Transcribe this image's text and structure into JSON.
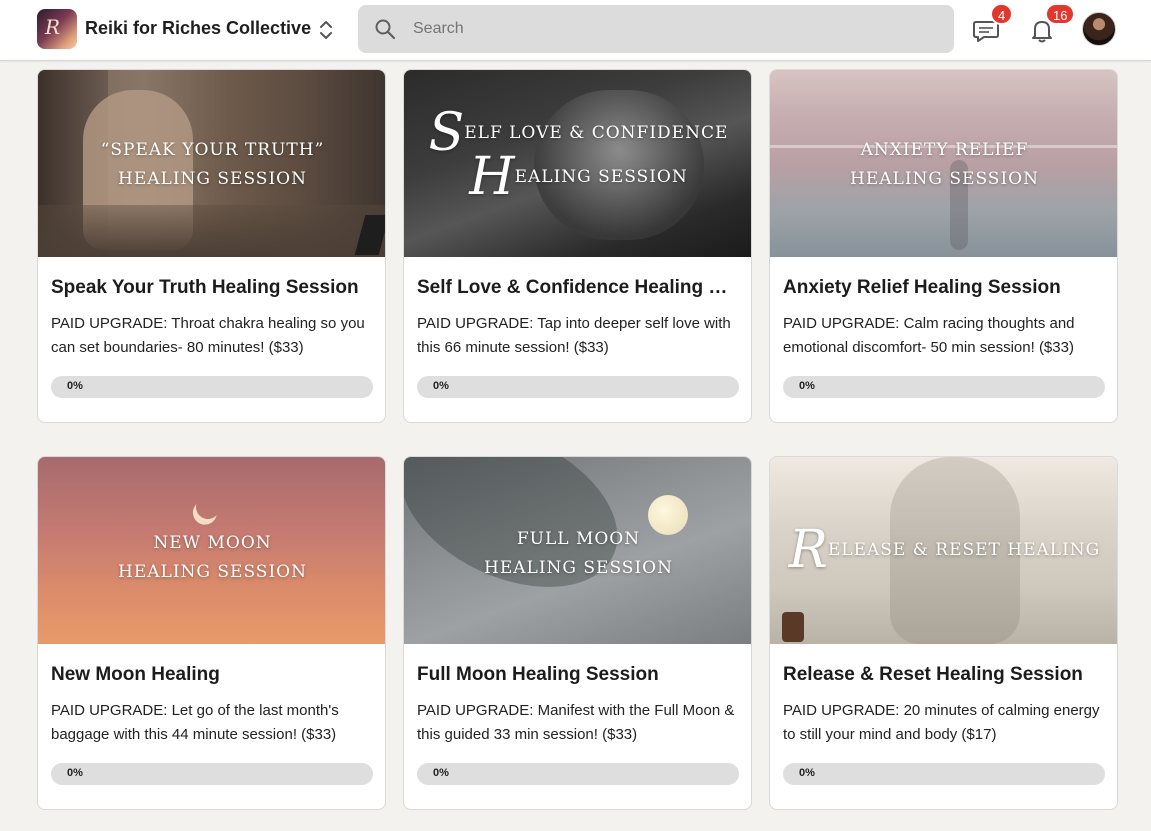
{
  "header": {
    "brand_name": "Reiki for Riches Collective",
    "logo_monogram": "R",
    "search_placeholder": "Search",
    "chat_count": "4",
    "notification_count": "16"
  },
  "courses": [
    {
      "thumb_lines": [
        "“SPEAK YOUR TRUTH”",
        "HEALING SESSION"
      ],
      "title": "Speak Your Truth Healing Session",
      "description": "PAID UPGRADE: Throat chakra healing so you can set boundaries- 80 minutes! ($33)",
      "progress_label": "0%",
      "progress": 0
    },
    {
      "thumb_script_1": "S",
      "thumb_rest_1": "ELF LOVE & CONFIDENCE",
      "thumb_script_2": "H",
      "thumb_rest_2": "EALING SESSION",
      "title": "Self Love & Confidence Healing S…",
      "description": "PAID UPGRADE: Tap into deeper self love with this 66 minute session! ($33)",
      "progress_label": "0%",
      "progress": 0
    },
    {
      "thumb_lines": [
        "ANXIETY RELIEF",
        "HEALING SESSION"
      ],
      "title": "Anxiety Relief Healing Session",
      "description": "PAID UPGRADE: Calm racing thoughts and emotional discomfort- 50 min session! ($33)",
      "progress_label": "0%",
      "progress": 0
    },
    {
      "thumb_lines": [
        "NEW MOON",
        "HEALING SESSION"
      ],
      "title": "New Moon Healing",
      "description": "PAID UPGRADE: Let go of the last month's baggage with this 44 minute session! ($33)",
      "progress_label": "0%",
      "progress": 0
    },
    {
      "thumb_lines": [
        "FULL MOON",
        "HEALING SESSION"
      ],
      "title": "Full Moon Healing Session",
      "description": "PAID UPGRADE: Manifest with the Full Moon & this guided 33 min session! ($33)",
      "progress_label": "0%",
      "progress": 0
    },
    {
      "thumb_script_1": "R",
      "thumb_rest_1": "ELEASE & RESET HEALING",
      "title": "Release & Reset Healing Session",
      "description": "PAID UPGRADE: 20 minutes of calming energy to still your mind and body ($17)",
      "progress_label": "0%",
      "progress": 0
    }
  ],
  "colors": {
    "badge": "#e2372d",
    "progress_track": "#dedede",
    "header_bg": "#ffffff",
    "page_bg": "#f3f2ef"
  },
  "icons": [
    "search-icon",
    "chat-bubble-icon",
    "bell-icon",
    "chevron-up-down-icon"
  ]
}
